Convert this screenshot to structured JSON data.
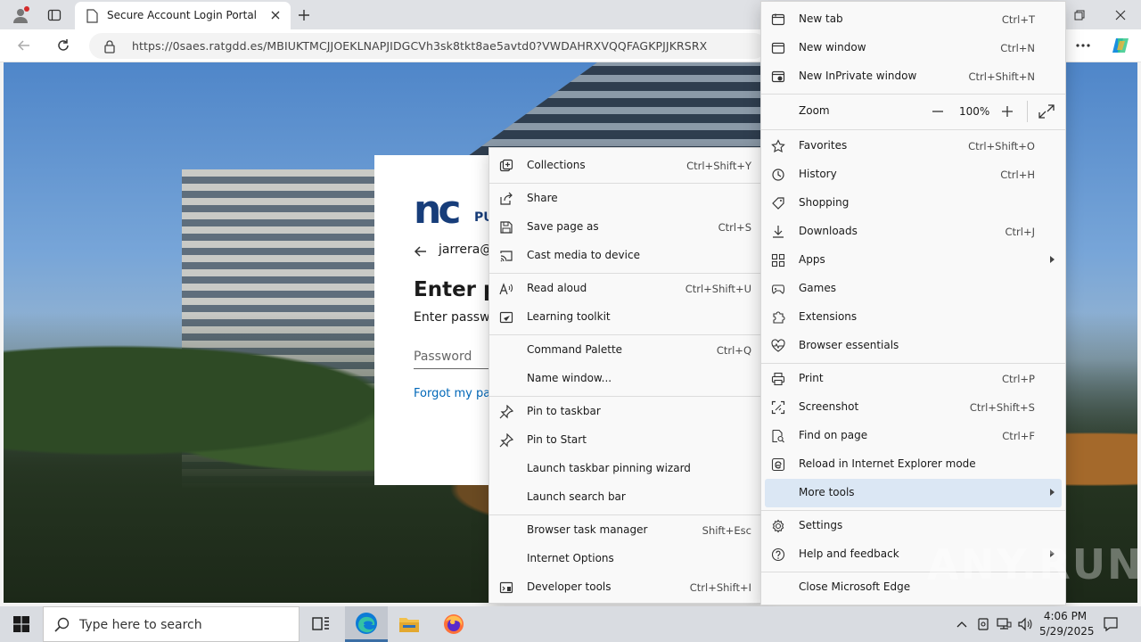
{
  "browser": {
    "tab_title": "Secure Account Login Portal",
    "url": "https://0saes.ratgdd.es/MBIUKTMCJJOEKLNAPJIDGCVh3sk8tkt8ae5avtd0?VWDAHRXVQQFAGKPJJKRSRX"
  },
  "page": {
    "logo_text": "nc",
    "logo_suffix": "PU",
    "email": "jarrera@",
    "title": "Enter pa",
    "subtitle": "Enter passwo",
    "password_placeholder": "Password",
    "forgot_link": "Forgot my pas"
  },
  "edge_menu": {
    "new_tab": {
      "label": "New tab",
      "shortcut": "Ctrl+T"
    },
    "new_window": {
      "label": "New window",
      "shortcut": "Ctrl+N"
    },
    "new_inprivate": {
      "label": "New InPrivate window",
      "shortcut": "Ctrl+Shift+N"
    },
    "zoom": {
      "label": "Zoom",
      "value": "100%"
    },
    "favorites": {
      "label": "Favorites",
      "shortcut": "Ctrl+Shift+O"
    },
    "history": {
      "label": "History",
      "shortcut": "Ctrl+H"
    },
    "shopping": {
      "label": "Shopping"
    },
    "downloads": {
      "label": "Downloads",
      "shortcut": "Ctrl+J"
    },
    "apps": {
      "label": "Apps"
    },
    "games": {
      "label": "Games"
    },
    "extensions": {
      "label": "Extensions"
    },
    "browser_essentials": {
      "label": "Browser essentials"
    },
    "print": {
      "label": "Print",
      "shortcut": "Ctrl+P"
    },
    "screenshot": {
      "label": "Screenshot",
      "shortcut": "Ctrl+Shift+S"
    },
    "find_on_page": {
      "label": "Find on page",
      "shortcut": "Ctrl+F"
    },
    "ie_mode": {
      "label": "Reload in Internet Explorer mode"
    },
    "more_tools": {
      "label": "More tools"
    },
    "settings": {
      "label": "Settings"
    },
    "help_feedback": {
      "label": "Help and feedback"
    },
    "close_edge": {
      "label": "Close Microsoft Edge"
    }
  },
  "more_tools_menu": {
    "collections": {
      "label": "Collections",
      "shortcut": "Ctrl+Shift+Y"
    },
    "share": {
      "label": "Share"
    },
    "save_page_as": {
      "label": "Save page as",
      "shortcut": "Ctrl+S"
    },
    "cast_media": {
      "label": "Cast media to device"
    },
    "read_aloud": {
      "label": "Read aloud",
      "shortcut": "Ctrl+Shift+U"
    },
    "learning_toolkit": {
      "label": "Learning toolkit"
    },
    "command_palette": {
      "label": "Command Palette",
      "shortcut": "Ctrl+Q"
    },
    "name_window": {
      "label": "Name window..."
    },
    "pin_taskbar": {
      "label": "Pin to taskbar"
    },
    "pin_start": {
      "label": "Pin to Start"
    },
    "launch_pinning_wizard": {
      "label": "Launch taskbar pinning wizard"
    },
    "launch_search_bar": {
      "label": "Launch search bar"
    },
    "task_manager": {
      "label": "Browser task manager",
      "shortcut": "Shift+Esc"
    },
    "internet_options": {
      "label": "Internet Options"
    },
    "developer_tools": {
      "label": "Developer tools",
      "shortcut": "Ctrl+Shift+I"
    }
  },
  "watermark": "ANY.RUN",
  "taskbar": {
    "search_placeholder": "Type here to search",
    "time": "4:06 PM",
    "date": "5/29/2025"
  },
  "colors": {
    "menu_bg": "#f9f9f9",
    "highlight": "#dbe7f4",
    "link": "#0067b8",
    "brand": "#173d7a"
  }
}
